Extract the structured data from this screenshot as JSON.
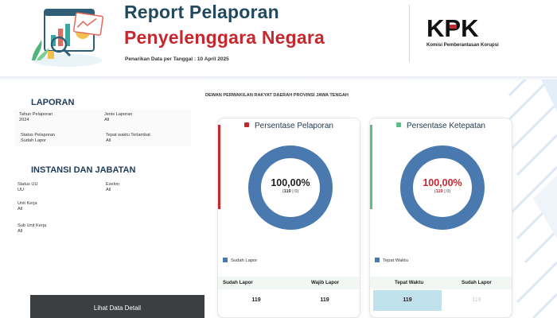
{
  "header": {
    "title_line1": "Report Pelaporan",
    "title_line2": "Penyelenggara Negara",
    "data_date": "Penarikan Data per Tanggal : 10 April 2025",
    "logo_text": "KPK",
    "logo_caption": "Komisi Pemberantasan Korupsi"
  },
  "region_title": "DEWAN PERWAKILAN RAKYAT DAERAH PROVINSI JAWA TENGAH",
  "laporan": {
    "title": "LAPORAN",
    "tahun_label": "Tahun Pelaporan",
    "tahun_value": "2024",
    "jenis_label": "Jenis Laporan",
    "jenis_value": "All",
    "status_label": "Status Pelaporan",
    "status_value": "Sudah Lapor",
    "tepat_label": "Tepat waktu Terlambat",
    "tepat_value": "All"
  },
  "instansi": {
    "title": "INSTANSI DAN JABATAN",
    "status_uu_label": "Status UU",
    "status_uu_value": "UU",
    "eselon_label": "Eselon",
    "eselon_value": "All",
    "unit_kerja_label": "Unit Kerja",
    "unit_kerja_value": "All",
    "sub_unit_label": "Sub Unit Kerja",
    "sub_unit_value": "All"
  },
  "detail_button_label": "Lihat Data Detail",
  "colors": {
    "donut_blue": "#4a79b0",
    "red_accent": "#c6282e",
    "green_accent": "#5cbf8a",
    "title_navy": "#22495e"
  },
  "card_pelaporan": {
    "title": "Persentase Pelaporan",
    "percent": "100,00%",
    "sub_open": "(",
    "sub_num": "119",
    "sub_rest": " | 0)",
    "legend": "Sudah Lapor",
    "col1_label": "Sudah Lapor",
    "col2_label": "Wajib Lapor",
    "col1_value": "119",
    "col2_value": "119"
  },
  "card_ketepatan": {
    "title": "Persentase Ketepatan",
    "percent": "100,00%",
    "sub_open": "(",
    "sub_num": "119",
    "sub_rest": " | 0)",
    "legend": "Tepat Waktu",
    "col1_label": "Tepat Waktu",
    "col2_label": "Sudah Lapor",
    "col1_value": "119",
    "col2_value": "119"
  }
}
